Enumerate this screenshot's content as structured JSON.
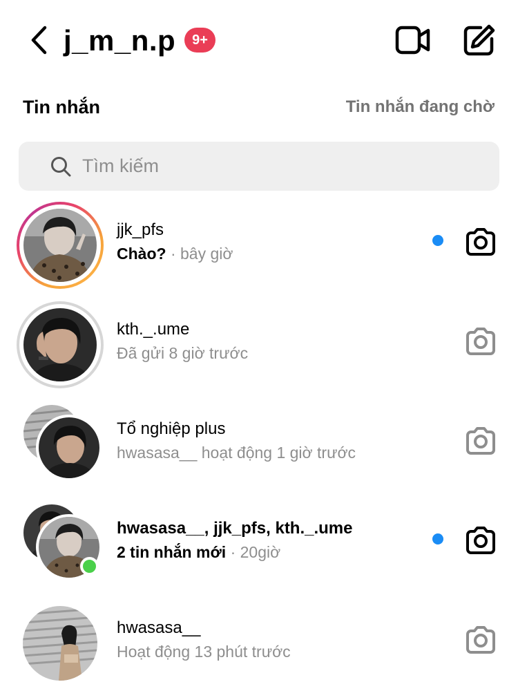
{
  "header": {
    "username": "j_m_n.p",
    "badge": "9+",
    "icons": {
      "back": "chevron-left-icon",
      "video": "video-camera-icon",
      "compose": "new-message-icon"
    }
  },
  "section": {
    "title": "Tin nhắn",
    "requests_link": "Tin nhắn đang chờ"
  },
  "search": {
    "placeholder": "Tìm kiếm",
    "value": ""
  },
  "colors": {
    "badge": "#ea3d56",
    "unread_dot": "#1a8cf5",
    "online_dot": "#4ad04a",
    "secondary_text": "#8e8e8e",
    "search_bg": "#efefef"
  },
  "conversations": [
    {
      "name": "jjk_pfs",
      "message": "Chào?",
      "time": "· bây giờ",
      "unread": true,
      "story_ring": true
    },
    {
      "name": "kth._.ume",
      "message": "Đã gửi 8 giờ trước",
      "time": "",
      "unread": false,
      "story_ring": false
    },
    {
      "name": "Tổ nghiệp plus",
      "message": "hwasasa__ hoạt động 1 giờ trước",
      "time": "",
      "unread": false,
      "group": true
    },
    {
      "name": "hwasasa__, jjk_pfs, kth._.ume",
      "message": "2 tin nhắn mới",
      "time": "· 20giờ",
      "unread": true,
      "group": true,
      "online": true
    },
    {
      "name": "hwasasa__",
      "message": "Hoạt động 13 phút trước",
      "time": "",
      "unread": false
    }
  ]
}
